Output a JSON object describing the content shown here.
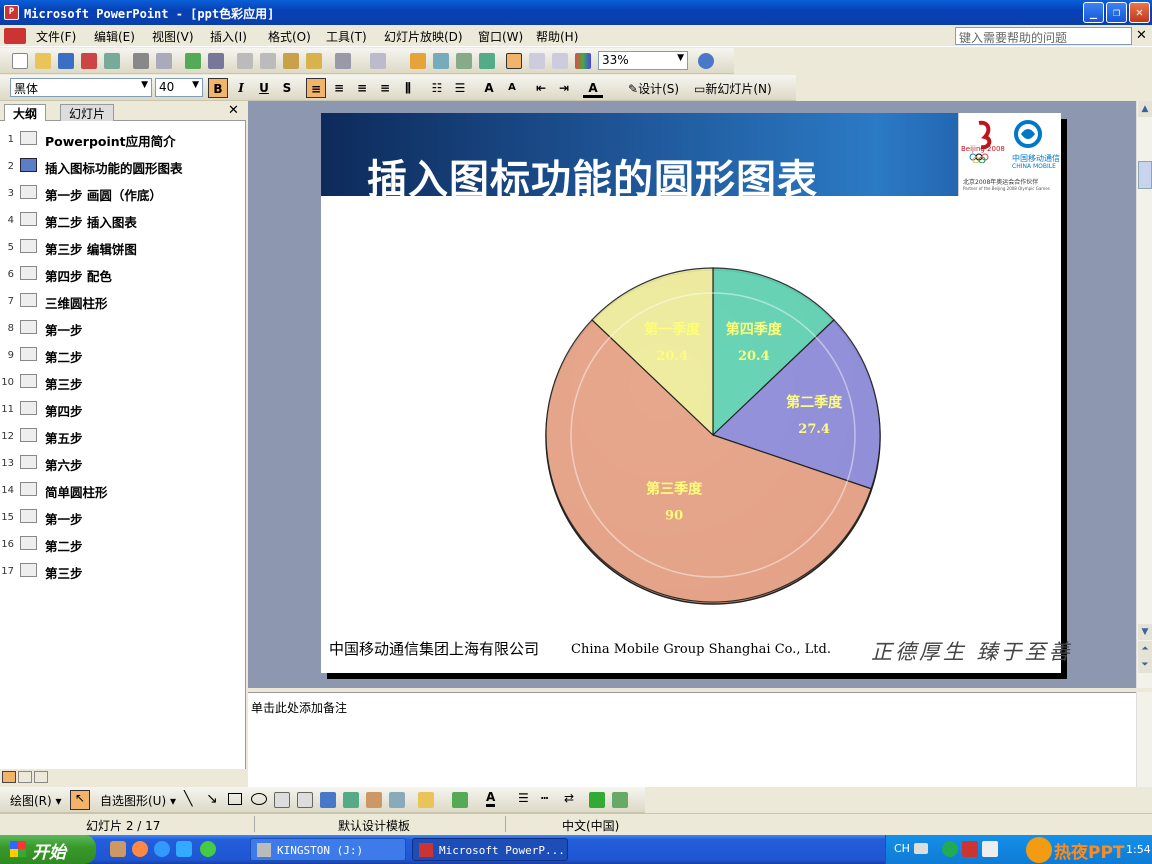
{
  "window": {
    "title": "Microsoft PowerPoint - [ppt色彩应用]"
  },
  "menu": {
    "items": [
      "文件(F)",
      "编辑(E)",
      "视图(V)",
      "插入(I)",
      "格式(O)",
      "工具(T)",
      "幻灯片放映(D)",
      "窗口(W)",
      "帮助(H)"
    ],
    "help_placeholder": "键入需要帮助的问题"
  },
  "toolbar": {
    "zoom": "33%",
    "font_name": "黑体",
    "font_size": "40",
    "design_label": "设计(S)",
    "new_slide_label": "新幻灯片(N)"
  },
  "outline_pane": {
    "tabs": [
      "大纲",
      "幻灯片"
    ],
    "selected_index": 1,
    "items": [
      {
        "num": "1",
        "label": "Powerpoint应用简介"
      },
      {
        "num": "2",
        "label": "插入图标功能的圆形图表"
      },
      {
        "num": "3",
        "label": "第一步  画圆（作底）"
      },
      {
        "num": "4",
        "label": "第二步  插入图表"
      },
      {
        "num": "5",
        "label": "第三步  编辑饼图"
      },
      {
        "num": "6",
        "label": "第四步  配色"
      },
      {
        "num": "7",
        "label": "三维圆柱形"
      },
      {
        "num": "8",
        "label": "第一步"
      },
      {
        "num": "9",
        "label": "第二步"
      },
      {
        "num": "10",
        "label": "第三步"
      },
      {
        "num": "11",
        "label": "第四步"
      },
      {
        "num": "12",
        "label": "第五步"
      },
      {
        "num": "13",
        "label": "第六步"
      },
      {
        "num": "14",
        "label": "简单圆柱形"
      },
      {
        "num": "15",
        "label": "第一步"
      },
      {
        "num": "16",
        "label": "第二步"
      },
      {
        "num": "17",
        "label": "第三步"
      }
    ]
  },
  "slide": {
    "title": "插入图标功能的圆形图表",
    "footer_cn": "中国移动通信集团上海有限公司",
    "footer_en": "China Mobile Group Shanghai Co., Ltd.",
    "motto": "正德厚生  臻于至善",
    "logo_caption": "北京2008年奥运会合作伙伴",
    "logo_caption_en": "Partner of the Beijing 2008 Olympic Games",
    "logo_brand": "中国移动通信",
    "logo_brand_en": "CHINA MOBILE",
    "logo_beijing": "Beijing 2008"
  },
  "chart_data": {
    "type": "pie",
    "categories": [
      "第一季度",
      "第二季度",
      "第三季度",
      "第四季度"
    ],
    "values": [
      20.4,
      27.4,
      90,
      20.4
    ],
    "colors": [
      "#eef0a0",
      "#8c8fe0",
      "#e6a58a",
      "#5fd6b8"
    ]
  },
  "notes": {
    "placeholder": "单击此处添加备注"
  },
  "drawing_toolbar": {
    "draw_label": "绘图(R)",
    "autoshape_label": "自选图形(U)"
  },
  "status": {
    "slide": "幻灯片 2 / 17",
    "template": "默认设计模板",
    "language": "中文(中国)"
  },
  "taskbar": {
    "start": "开始",
    "tasks": [
      "KINGSTON (J:)",
      "Microsoft PowerP..."
    ],
    "ime": "CH",
    "clock": "1:54",
    "watermark": "热夜PPT"
  }
}
